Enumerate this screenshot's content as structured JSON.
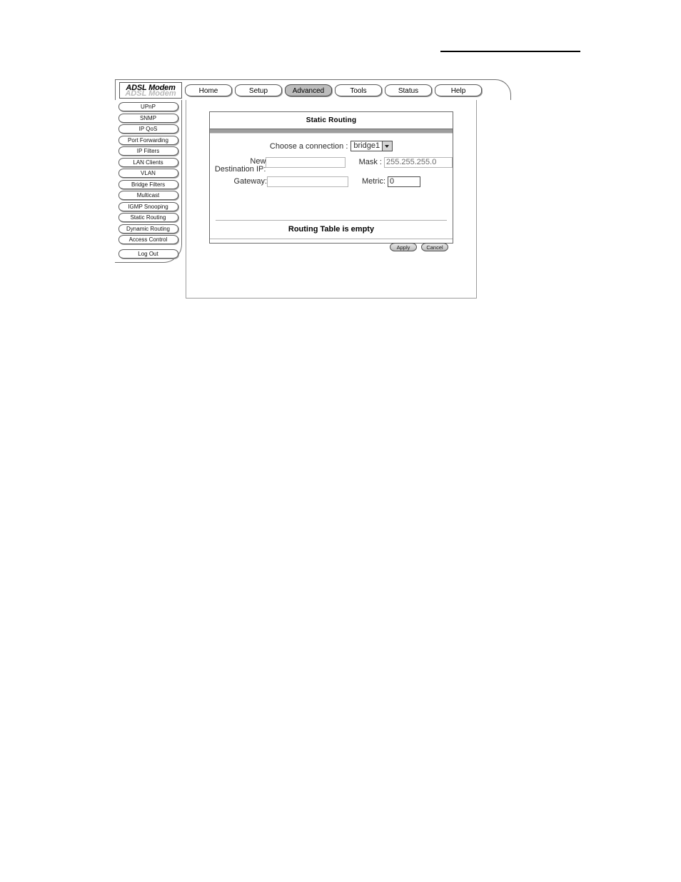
{
  "product": {
    "logo_text": "ADSL Modem"
  },
  "nav": {
    "tabs": [
      {
        "label": "Home",
        "active": false
      },
      {
        "label": "Setup",
        "active": false
      },
      {
        "label": "Advanced",
        "active": true
      },
      {
        "label": "Tools",
        "active": false
      },
      {
        "label": "Status",
        "active": false
      },
      {
        "label": "Help",
        "active": false
      }
    ]
  },
  "sidebar": {
    "items": [
      {
        "label": "UPnP"
      },
      {
        "label": "SNMP"
      },
      {
        "label": "IP QoS"
      },
      {
        "label": "Port Forwarding"
      },
      {
        "label": "IP Filters"
      },
      {
        "label": "LAN Clients"
      },
      {
        "label": "VLAN"
      },
      {
        "label": "Bridge Filters"
      },
      {
        "label": "Multicast"
      },
      {
        "label": "IGMP Snooping"
      },
      {
        "label": "Static Routing"
      },
      {
        "label": "Dynamic Routing"
      },
      {
        "label": "Access Control"
      }
    ],
    "logout": {
      "label": "Log Out"
    }
  },
  "main": {
    "card_title": "Static Routing",
    "connection": {
      "label": "Choose a connection :",
      "selected": "bridge1"
    },
    "fields": {
      "destination_label": "New Destination IP:",
      "destination_value": "",
      "mask_label": "Mask :",
      "mask_value": "255.255.255.0",
      "gateway_label": "Gateway:",
      "gateway_value": "",
      "metric_label": "Metric:",
      "metric_value": "0"
    },
    "table_status": "Routing Table is empty",
    "buttons": {
      "apply": "Apply",
      "cancel": "Cancel"
    }
  }
}
